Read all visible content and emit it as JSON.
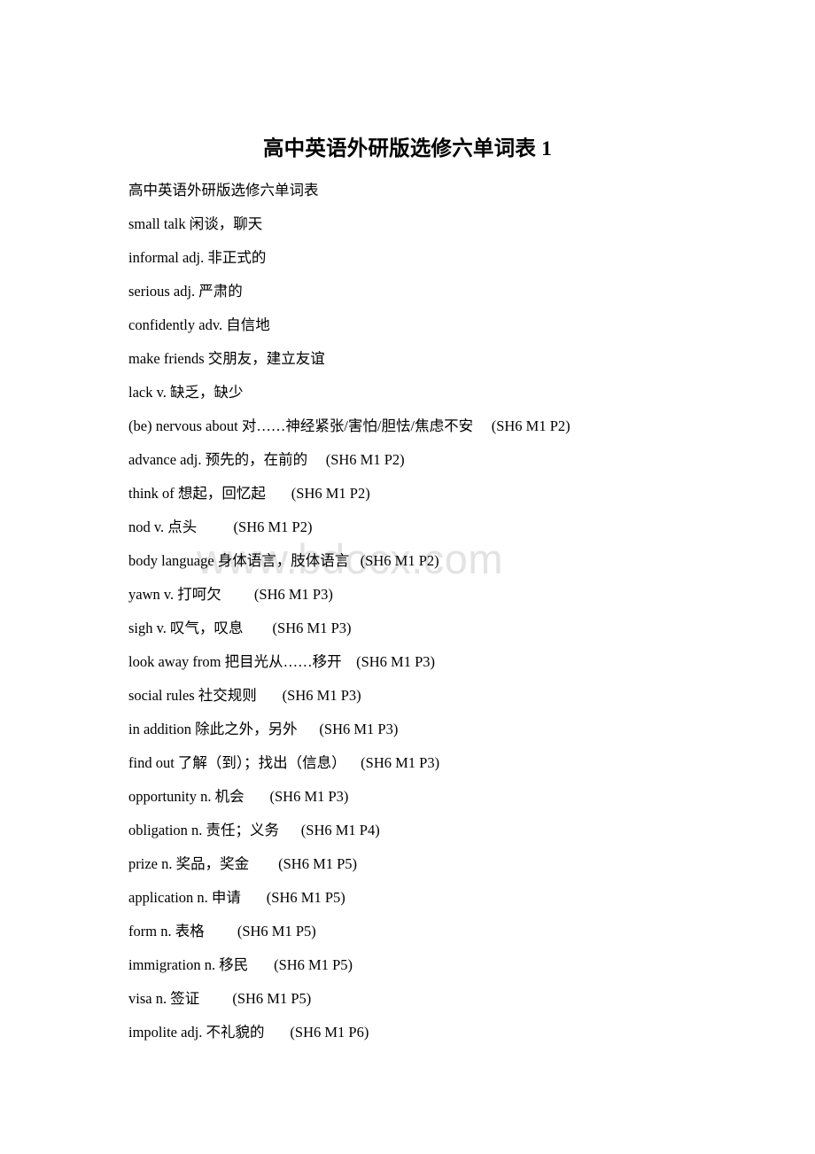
{
  "document": {
    "title": "高中英语外研版选修六单词表 1",
    "watermark": "www.bdocx.com",
    "intro": "高中英语外研版选修六单词表",
    "lines": [
      {
        "text": "small talk 闲谈，聊天"
      },
      {
        "text": "informal adj. 非正式的"
      },
      {
        "text": "serious adj. 严肃的"
      },
      {
        "text": "confidently adv. 自信地"
      },
      {
        "text": "make friends 交朋友，建立友谊"
      },
      {
        "text": "lack v. 缺乏，缺少"
      },
      {
        "text": "(be) nervous about 对……神经紧张/害怕/胆怯/焦虑不安     (SH6 M1 P2)"
      },
      {
        "text": "advance adj. 预先的，在前的     (SH6 M1 P2)"
      },
      {
        "text": "think of 想起，回忆起       (SH6 M1 P2)"
      },
      {
        "text": "nod v. 点头          (SH6 M1 P2)"
      },
      {
        "text": "body language 身体语言，肢体语言   (SH6 M1 P2)"
      },
      {
        "text": "yawn v. 打呵欠         (SH6 M1 P3)"
      },
      {
        "text": "sigh v. 叹气，叹息        (SH6 M1 P3)"
      },
      {
        "text": "look away from 把目光从……移开    (SH6 M1 P3)"
      },
      {
        "text": "social rules 社交规则       (SH6 M1 P3)"
      },
      {
        "text": "in addition 除此之外，另外      (SH6 M1 P3)"
      },
      {
        "text": "find out 了解（到）；找出（信息）    (SH6 M1 P3)"
      },
      {
        "text": "opportunity n. 机会       (SH6 M1 P3)"
      },
      {
        "text": "obligation n. 责任；义务      (SH6 M1 P4)"
      },
      {
        "text": "prize n. 奖品，奖金        (SH6 M1 P5)"
      },
      {
        "text": "application n. 申请       (SH6 M1 P5)"
      },
      {
        "text": "form n. 表格         (SH6 M1 P5)"
      },
      {
        "text": "immigration n. 移民       (SH6 M1 P5)"
      },
      {
        "text": "visa n. 签证         (SH6 M1 P5)"
      },
      {
        "text": "impolite adj. 不礼貌的       (SH6 M1 P6)"
      }
    ]
  }
}
